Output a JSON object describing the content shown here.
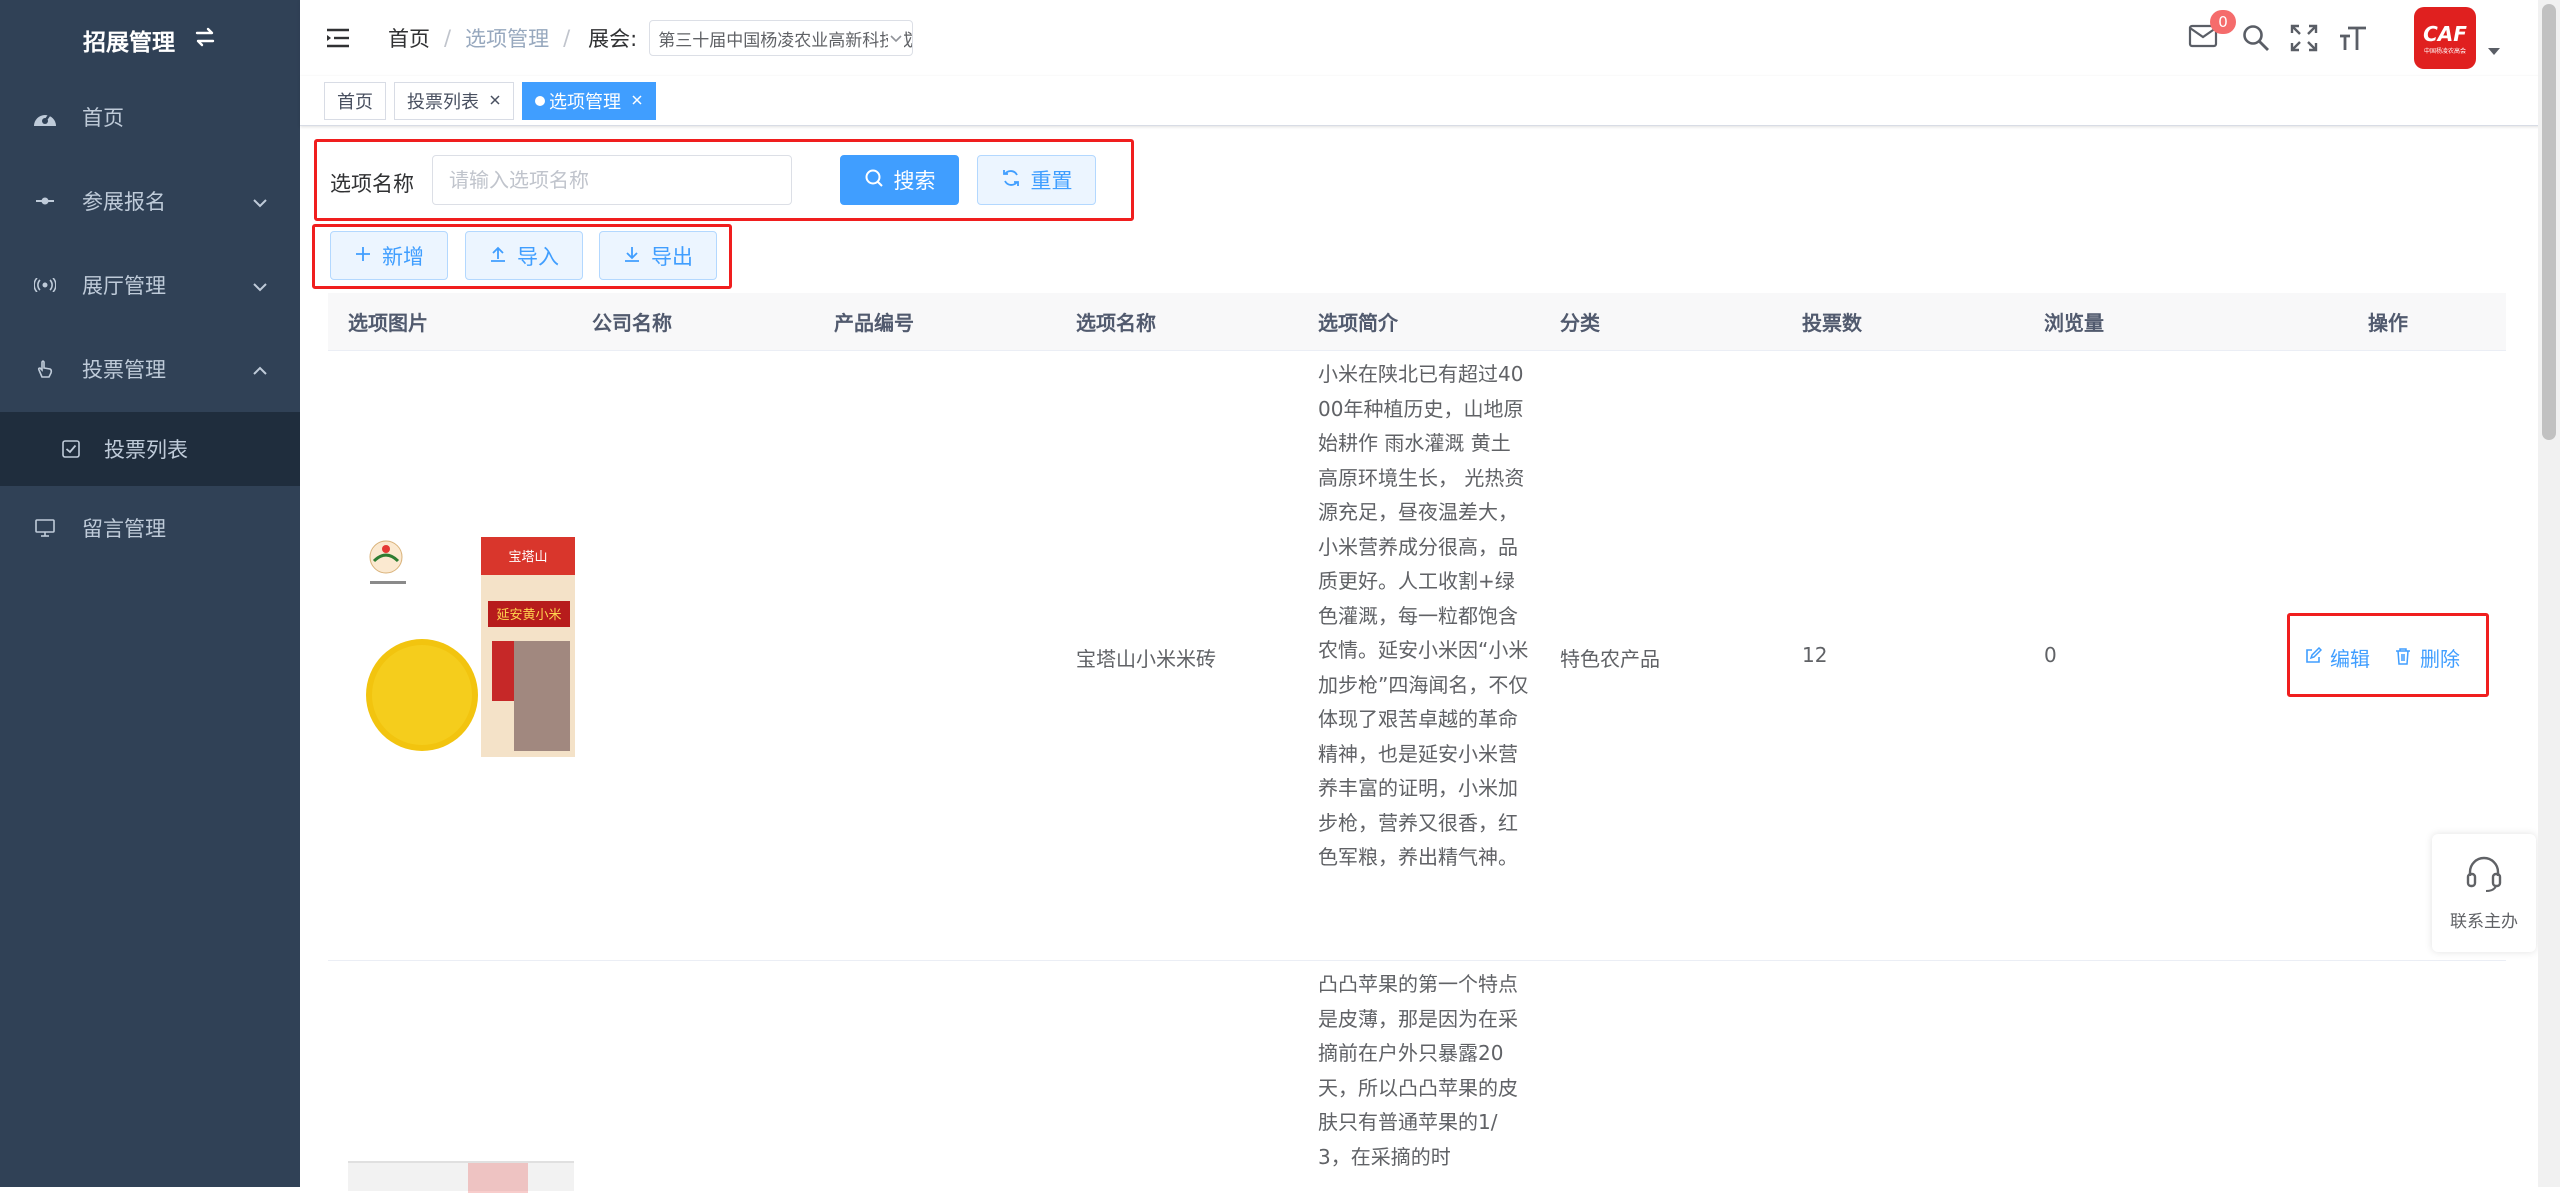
{
  "sidebar": {
    "title": "招展管理",
    "items": [
      {
        "label": "首页",
        "icon": "dashboard-icon"
      },
      {
        "label": "参展报名",
        "icon": "registration-icon"
      },
      {
        "label": "展厅管理",
        "icon": "broadcast-icon"
      },
      {
        "label": "投票管理",
        "icon": "hand-pointer-icon"
      },
      {
        "label": "留言管理",
        "icon": "monitor-icon"
      }
    ],
    "sub_item": {
      "label": "投票列表",
      "icon": "checkbox-icon"
    }
  },
  "navbar": {
    "breadcrumb": [
      "首页",
      "选项管理"
    ],
    "expo_label": "展会:",
    "expo_value": "第三十届中国杨凌农业高新科技成果博览会",
    "mail_badge": "0",
    "avatar_text": "CAF",
    "avatar_subtext": "中国杨凌农高会"
  },
  "tags": [
    {
      "label": "首页"
    },
    {
      "label": "投票列表"
    },
    {
      "label": "选项管理"
    }
  ],
  "search": {
    "label": "选项名称",
    "placeholder": "请输入选项名称",
    "search_button": "搜索",
    "reset_button": "重置"
  },
  "toolbar": {
    "add": "新增",
    "import": "导入",
    "export": "导出"
  },
  "table": {
    "headers": [
      "选项图片",
      "公司名称",
      "产品编号",
      "选项名称",
      "选项简介",
      "分类",
      "投票数",
      "浏览量",
      "操作"
    ],
    "rows": [
      {
        "company": "",
        "code": "",
        "name": "宝塔山小米米砖",
        "description": "小米在陕北已有超过4000年种植历史，山地原始耕作 雨水灌溉 黄土高原环境生长， 光热资源充足，昼夜温差大，小米营养成分很高，品质更好。人工收割+绿色灌溉，每一粒都饱含农情。延安小米因“小米加步枪”四海闻名，不仅体现了艰苦卓越的革命精神，也是延安小米营养丰富的证明，小米加步枪，营养又很香，红色军粮，养出精气神。",
        "category": "特色农产品",
        "votes": "12",
        "views": "0",
        "edit": "编辑",
        "delete": "删除",
        "image_labels": [
          "宝塔山",
          "延安黄小米"
        ]
      },
      {
        "description": "凸凸苹果的第一个特点是皮薄，那是因为在采摘前在户外只暴露20天，所以凸凸苹果的皮肤只有普通苹果的1/3，在采摘的时"
      }
    ]
  },
  "contact": {
    "label": "联系主办"
  },
  "colors": {
    "primary": "#409eff",
    "sidebar": "#304156",
    "highlight": "#f01e1e"
  }
}
